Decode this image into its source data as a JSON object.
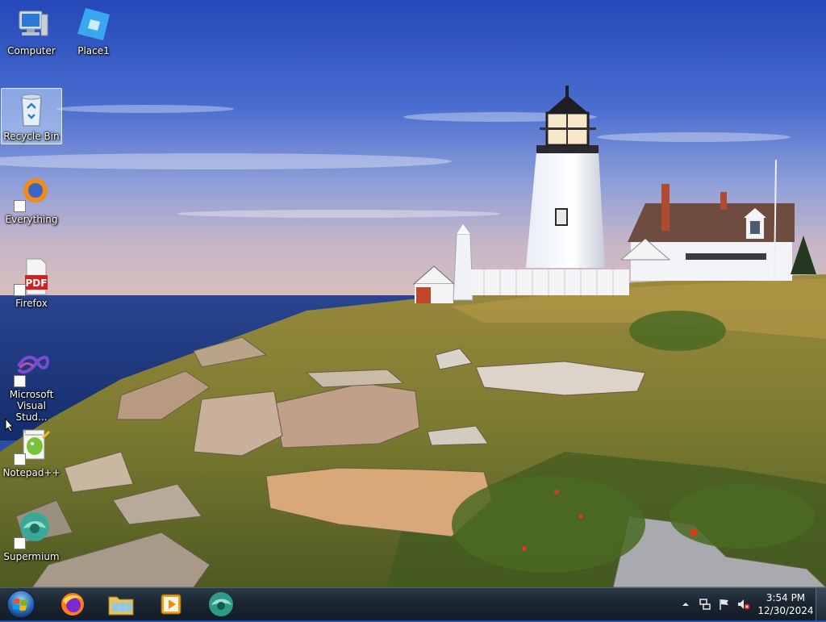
{
  "desktop": {
    "icons": [
      {
        "label": "Computer",
        "icon": "computer-icon",
        "shortcut": false,
        "selected": false
      },
      {
        "label": "Place1",
        "icon": "place1-icon",
        "shortcut": false,
        "selected": false
      },
      {
        "label": "Recycle Bin",
        "icon": "recycle-bin-icon",
        "shortcut": false,
        "selected": true
      },
      {
        "label": "Everything",
        "icon": "everything-icon",
        "shortcut": true,
        "selected": false
      },
      {
        "label": "Firefox",
        "icon": "pdf-icon",
        "shortcut": true,
        "selected": false
      },
      {
        "label": "Microsoft Visual Stud...",
        "icon": "visual-studio-icon",
        "shortcut": true,
        "selected": false
      },
      {
        "label": "Notepad++",
        "icon": "notepad-plus-plus-icon",
        "shortcut": true,
        "selected": false
      },
      {
        "label": "Supermium",
        "icon": "supermium-icon",
        "shortcut": true,
        "selected": false
      }
    ]
  },
  "taskbar": {
    "start_icon": "windows-start-icon",
    "pinned": [
      {
        "icon": "firefox-icon"
      },
      {
        "icon": "file-explorer-icon"
      },
      {
        "icon": "media-player-icon"
      },
      {
        "icon": "supermium-icon"
      }
    ],
    "tray": {
      "icons": [
        "show-hidden-icons-icon",
        "network-icon",
        "action-center-flag-icon",
        "volume-muted-icon"
      ],
      "time": "3:54 PM",
      "date": "12/30/2024"
    }
  },
  "colors": {
    "sky_top": "#2b4cb8",
    "sea": "#243f8a",
    "grass": "#8a8a3a",
    "taskbar": "#1b2631"
  }
}
